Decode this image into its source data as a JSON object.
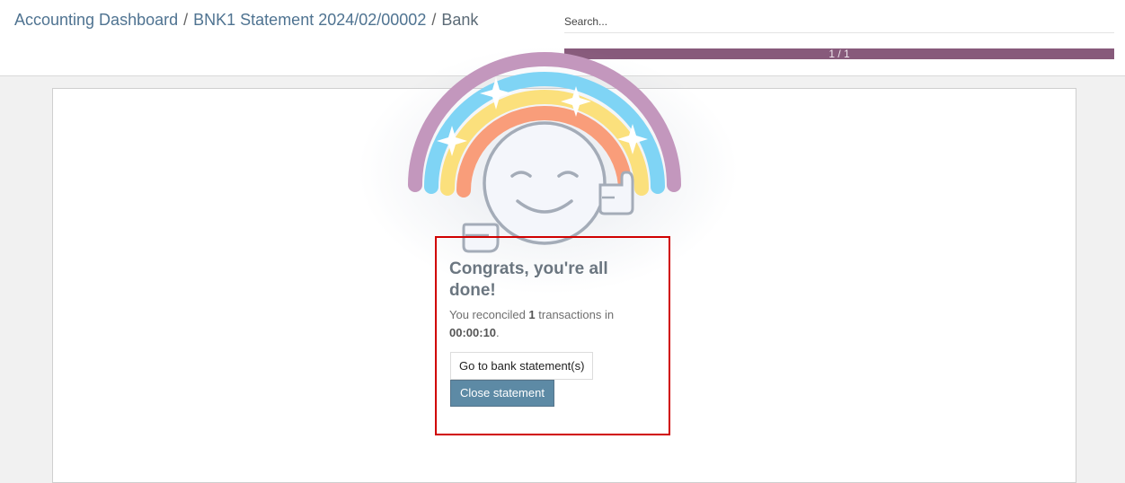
{
  "breadcrumb": {
    "items": [
      "Accounting Dashboard",
      "BNK1 Statement 2024/02/00002"
    ],
    "current": "Bank",
    "separator": "/"
  },
  "search": {
    "placeholder": "Search..."
  },
  "pager": {
    "label": "1 / 1"
  },
  "congrats": {
    "title": "Congrats, you're all done!",
    "text_prefix": "You reconciled ",
    "count": "1",
    "text_middle": " transactions in ",
    "duration": "00:00:10",
    "text_suffix": "."
  },
  "buttons": {
    "goto_label": "Go to bank statement(s)",
    "close_label": "Close statement"
  },
  "illustration": {
    "name": "rainbow-smiley-thumbs-up",
    "colors": {
      "outer": "#c397bd",
      "blue": "#7fd4f5",
      "yellow": "#fbe07c",
      "orange": "#f99d7a",
      "face": "#f4f6fb",
      "outline": "#a4acb8"
    }
  },
  "colors": {
    "link": "#4f7391",
    "pager": "#875a7b",
    "primary_button": "#5d8aa5",
    "highlight_border": "#d00000"
  }
}
